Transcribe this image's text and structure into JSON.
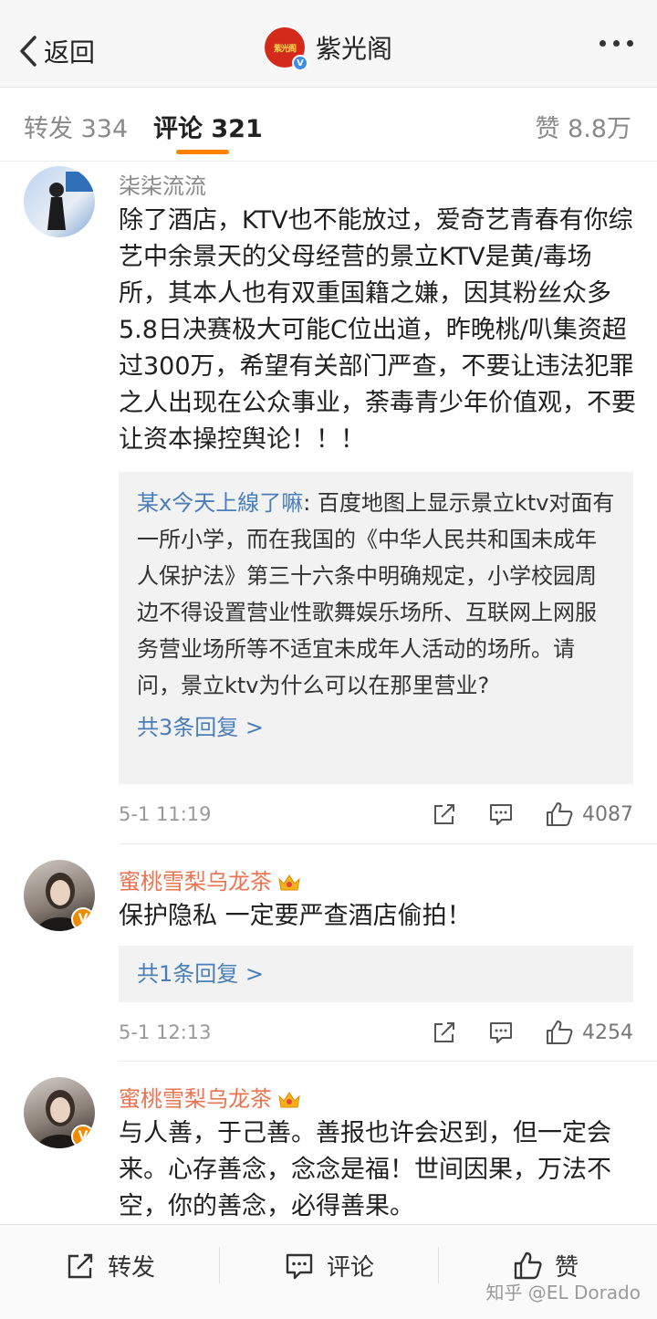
{
  "nav": {
    "back_label": "返回",
    "title": "紫光阁",
    "logo_text": "紫光阁"
  },
  "tabs": {
    "repost": "转发 334",
    "comments": "评论 321",
    "likes": "赞 8.8万"
  },
  "comments": [
    {
      "user": "柒柒流流",
      "text": "除了酒店，KTV也不能放过，爱奇艺青春有你综艺中余景天的父母经营的景立KTV是黄/毒场所，其本人也有双重国籍之嫌，因其粉丝众多5.8日决赛极大可能C位出道，昨晚桃/叭集资超过300万，希望有关部门严查，不要让违法犯罪之人出现在公众事业，荼毒青少年价值观，不要让资本操控舆论！！！",
      "reply_user": "某x今天上線了嘛",
      "reply_text": ": 百度地图上显示景立ktv对面有一所小学，而在我国的《中华人民共和国未成年人保护法》第三十六条中明确规定，小学校园周边不得设置营业性歌舞娱乐场所、互联网上网服务营业场所等不适宜未成年人活动的场所。请问，景立ktv为什么可以在那里营业?",
      "reply_more": "共3条回复 >",
      "time": "5-1 11:19",
      "likes": "4087"
    },
    {
      "user": "蜜桃雪梨乌龙茶",
      "text": "保护隐私 一定要严查酒店偷拍！",
      "reply_more": "共1条回复 >",
      "time": "5-1 12:13",
      "likes": "4254"
    },
    {
      "user": "蜜桃雪梨乌龙茶",
      "text": "与人善，于己善。善报也许会迟到，但一定会来。心存善念，念念是福！世间因果，万法不空，你的善念，必得善果。"
    }
  ],
  "bottom": {
    "repost": "转发",
    "comment": "评论",
    "like": "赞"
  },
  "watermark": "知乎 @EL Dorado",
  "colors": {
    "accent": "#ff8200",
    "link": "#4a7eb8",
    "vip_name": "#eb7350"
  }
}
